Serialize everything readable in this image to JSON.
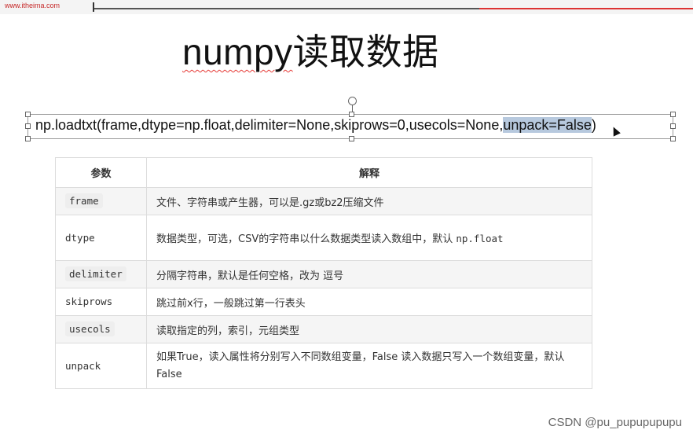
{
  "banner": {
    "logo_text": "www.itheima.com"
  },
  "slide": {
    "title_word": "numpy",
    "title_rest": "读取数据",
    "code_prefix": "np.loadtxt(frame,dtype=np.float,delimiter=None,skiprows=0,usecols=None,",
    "code_selected": "unpack=False",
    "code_suffix": ")"
  },
  "table": {
    "headers": [
      "参数",
      "解释"
    ],
    "rows": [
      {
        "param": "frame",
        "desc": "文件、字符串或产生器，可以是.gz或bz2压缩文件"
      },
      {
        "param": "dtype",
        "desc": "数据类型，可选，CSV的字符串以什么数据类型读入数组中，默认 ",
        "desc_code": "np.float"
      },
      {
        "param": "delimiter",
        "desc": "分隔字符串，默认是任何空格，改为 逗号"
      },
      {
        "param": "skiprows",
        "desc": "跳过前x行，一般跳过第一行表头"
      },
      {
        "param": "usecols",
        "desc": "读取指定的列，索引，元组类型"
      },
      {
        "param": "unpack",
        "desc": "如果True，读入属性将分别写入不同数组变量，False 读入数据只写入一个数组变量，默认False"
      }
    ]
  },
  "watermark": "CSDN @pu_pupupupupu",
  "colors": {
    "selection": "#b7c9de",
    "spellcheck": "#e53935",
    "row_shade": "#f5f5f5"
  }
}
